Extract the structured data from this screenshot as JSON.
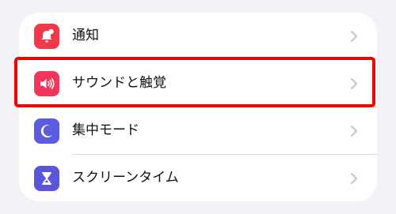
{
  "settings_group": {
    "items": [
      {
        "label": "通知",
        "icon": "bell-badge-icon",
        "icon_color": "#f2394c"
      },
      {
        "label": "サウンドと触覚",
        "icon": "speaker-wave-icon",
        "icon_color": "#f0365a"
      },
      {
        "label": "集中モード",
        "icon": "moon-icon",
        "icon_color": "#5c5ce0"
      },
      {
        "label": "スクリーンタイム",
        "icon": "hourglass-icon",
        "icon_color": "#5b55d9"
      }
    ]
  },
  "highlight": {
    "target": "サウンドと触覚",
    "color": "#f00000"
  }
}
